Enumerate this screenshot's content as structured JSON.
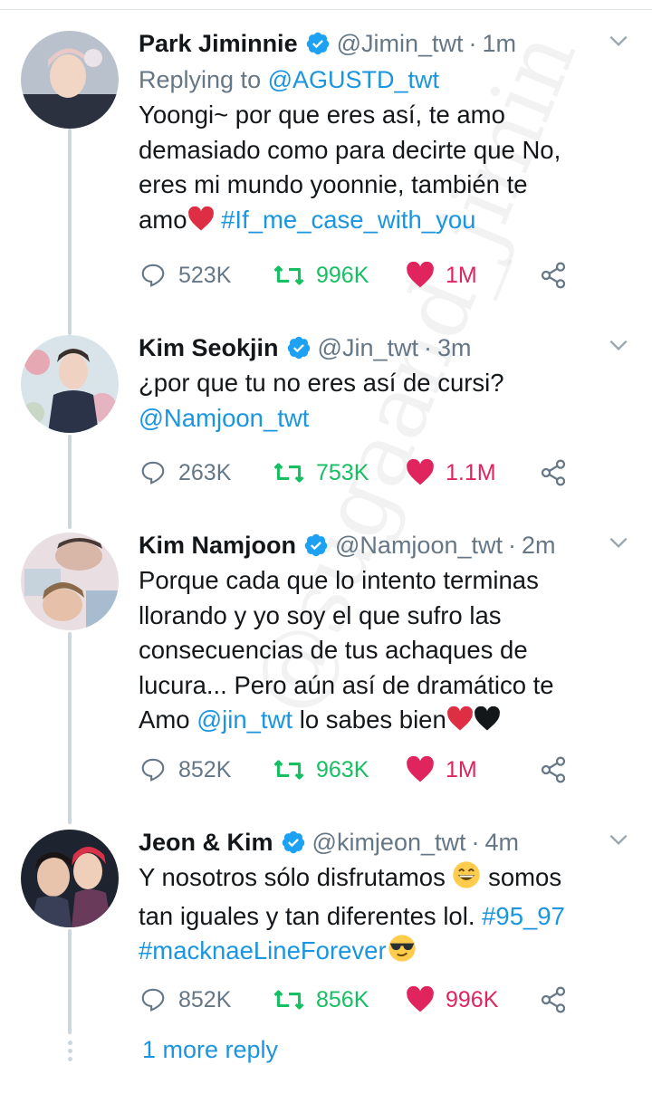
{
  "thread": {
    "more_reply": "1 more reply",
    "watermark": "@sugaand_jimin"
  },
  "colors": {
    "link": "#1b95e0",
    "retweet": "#17bf63",
    "like": "#e0245e",
    "muted": "#657786",
    "verified": "#1da1f2"
  },
  "tweets": [
    {
      "name": "Park Jiminnie",
      "handle": "@Jimin_twt",
      "time": "1m",
      "replying_label": "Replying to",
      "replying_to": "@AGUSTD_twt",
      "lines": [
        "Yoongi~ por que eres así, te amo",
        "demasiado como para decirte que No,",
        "eres mi mundo yoonnie, también te",
        "amo"
      ],
      "hashtag": "#If_me_case_with_you",
      "replies": "523K",
      "retweets": "996K",
      "likes": "1M"
    },
    {
      "name": "Kim Seokjin",
      "handle": "@Jin_twt",
      "time": "3m",
      "lines": [
        "¿por que tu no eres así de cursi?"
      ],
      "mention": "@Namjoon_twt",
      "replies": "263K",
      "retweets": "753K",
      "likes": "1.1M"
    },
    {
      "name": "Kim Namjoon",
      "handle": "@Namjoon_twt",
      "time": "2m",
      "lines": [
        "Porque cada que lo intento terminas",
        "llorando y yo soy el que sufro las",
        "consecuencias de tus achaques de",
        "lucura... Pero aún así de dramático te",
        "Amo"
      ],
      "mention": "@jin_twt",
      "tail": "lo sabes bien",
      "replies": "852K",
      "retweets": "963K",
      "likes": "1M"
    },
    {
      "name": "Jeon & Kim",
      "handle": "@kimjeon_twt",
      "time": "4m",
      "lines": [
        "Y nosotros sólo disfrutamos",
        "somos",
        "tan iguales y tan diferentes lol."
      ],
      "hashtag1": "#95_97",
      "hashtag2": "#macknaeLineForever",
      "replies": "852K",
      "retweets": "856K",
      "likes": "996K"
    }
  ]
}
